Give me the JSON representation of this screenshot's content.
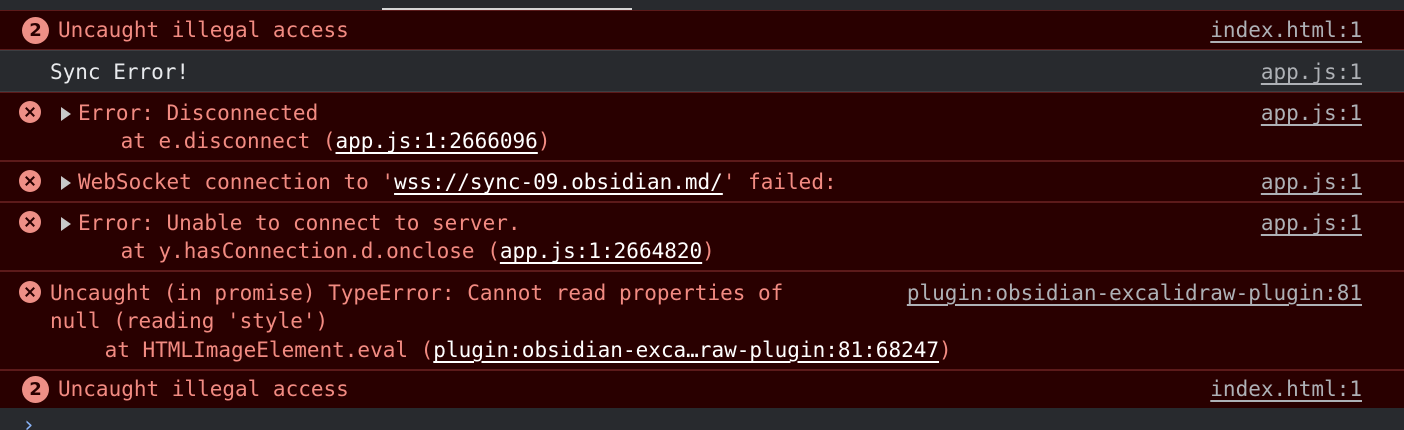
{
  "console": {
    "rows": [
      {
        "type": "grouped",
        "count": "2",
        "message": "Uncaught illegal access",
        "source": "index.html:1"
      },
      {
        "type": "log",
        "message": "Sync Error!",
        "source": "app.js:1"
      },
      {
        "type": "error",
        "message": "Error: Disconnected",
        "stack_prefix": "    at e.disconnect (",
        "stack_link": "app.js:1:2666096",
        "stack_suffix": ")",
        "source": "app.js:1"
      },
      {
        "type": "error",
        "message_prefix": "WebSocket connection to '",
        "message_link": "wss://sync-09.obsidian.md/",
        "message_suffix": "' failed:",
        "source": "app.js:1"
      },
      {
        "type": "error",
        "message": "Error: Unable to connect to server.",
        "stack_prefix": "    at y.hasConnection.d.onclose (",
        "stack_link": "app.js:1:2664820",
        "stack_suffix": ")",
        "source": "app.js:1"
      },
      {
        "type": "error",
        "message_line1": "Uncaught (in promise) TypeError: Cannot read properties of",
        "message_line2": "null (reading 'style')",
        "stack_prefix": "    at HTMLImageElement.eval (",
        "stack_link": "plugin:obsidian-exca…raw-plugin:81:68247",
        "stack_suffix": ")",
        "source": "plugin:obsidian-excalidraw-plugin:81"
      },
      {
        "type": "grouped",
        "count": "2",
        "message": "Uncaught illegal access",
        "source": "index.html:1"
      }
    ],
    "prompt_glyph": "›"
  },
  "colors": {
    "error_bg": "#290000",
    "error_text": "#f28b82",
    "log_text": "#e8eaed",
    "link": "#ffffff",
    "prompt": "#8ab4f8"
  }
}
